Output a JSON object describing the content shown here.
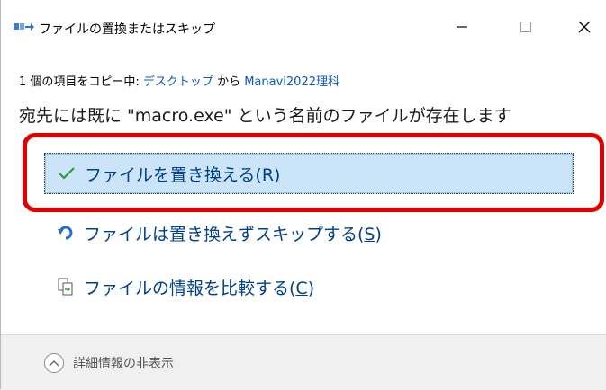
{
  "window": {
    "title": "ファイルの置換またはスキップ",
    "icon": "move-files-icon",
    "controls": [
      "minimize-icon",
      "maximize-icon",
      "close-icon"
    ]
  },
  "progress": {
    "count_text": "1 個の項目をコピー中: ",
    "source": "デスクトップ",
    "connector": " から ",
    "destination": "Manavi2022理科"
  },
  "heading": "宛先には既に \"macro.exe\" という名前のファイルが存在します",
  "options": [
    {
      "label": "ファイルを置き換える(",
      "key": "R",
      "close": ")",
      "icon": "checkmark-icon",
      "selected": true
    },
    {
      "label": "ファイルは置き換えずスキップする(",
      "key": "S",
      "close": ")",
      "icon": "skip-arrow-icon",
      "selected": false
    },
    {
      "label": "ファイルの情報を比較する(",
      "key": "C",
      "close": ")",
      "icon": "compare-files-icon",
      "selected": false
    }
  ],
  "footer": {
    "details_label": "詳細情報の非表示",
    "icon": "chevron-up-circle-icon"
  },
  "colors": {
    "accent_blue": "#003f8a",
    "link_blue": "#0a58c2",
    "selection_bg": "#cce4f7",
    "highlight_red": "#e10000",
    "check_green": "#2e9b35"
  }
}
